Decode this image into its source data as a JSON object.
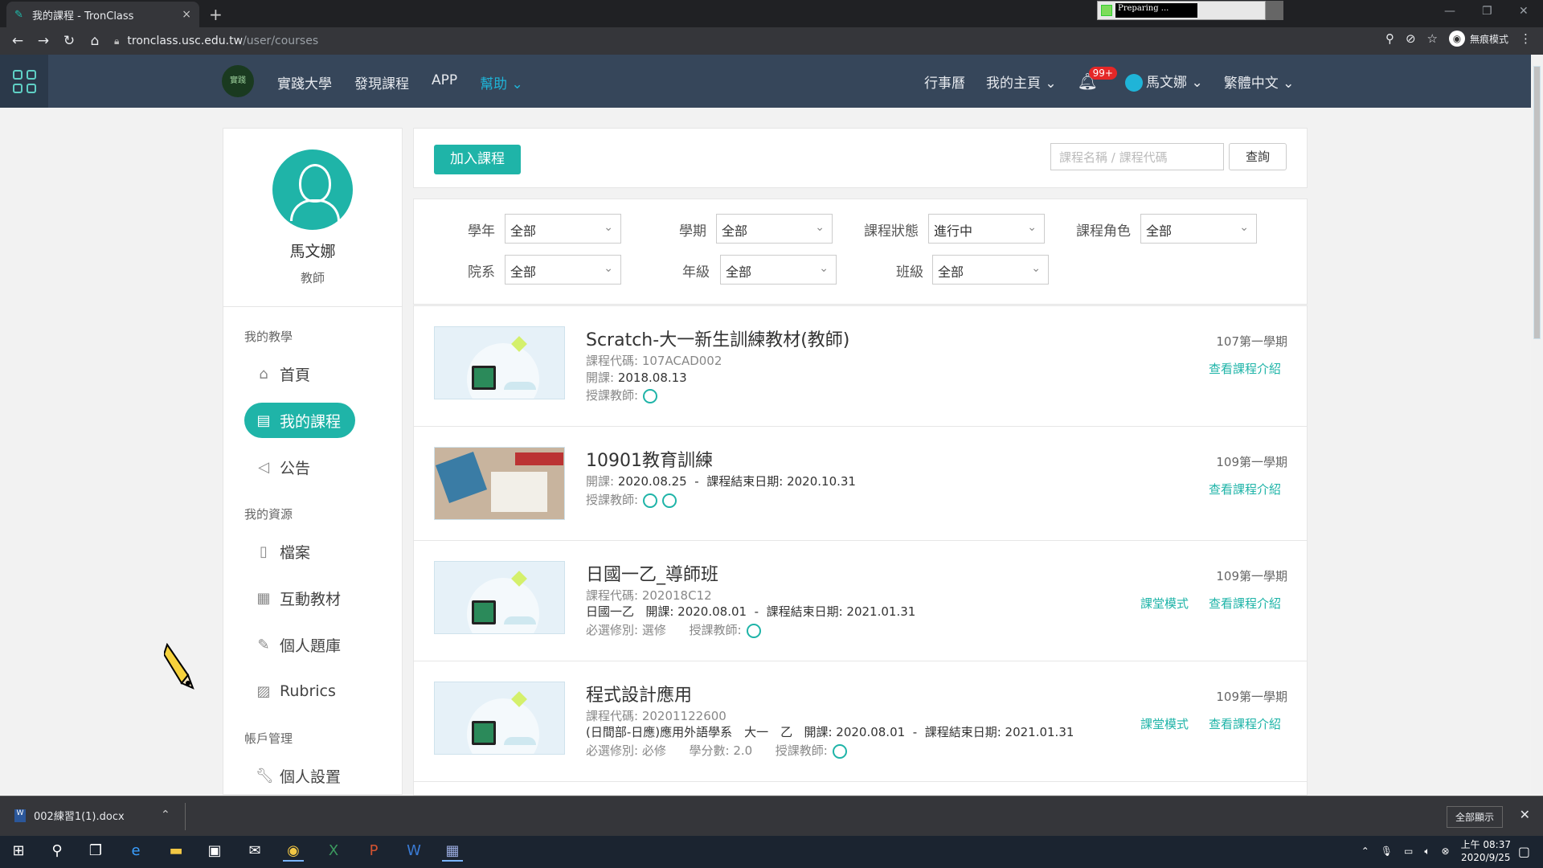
{
  "browser": {
    "tab_title": "我的課程 - TronClass",
    "tab_close": "×",
    "new_tab": "+",
    "preparing": "Preparing ...",
    "url_host": "tronclass.usc.edu.tw",
    "url_path": "/user/courses",
    "incognito": "無痕模式"
  },
  "topnav": {
    "logo_text": "實踐",
    "links": [
      "實踐大學",
      "發現課程",
      "APP"
    ],
    "help": "幫助",
    "calendar": "行事曆",
    "my_home": "我的主頁",
    "notif_count": "99+",
    "user": "馬文娜",
    "language": "繁體中文"
  },
  "sidebar": {
    "name": "馬文娜",
    "role": "教師",
    "section_teaching": "我的教學",
    "home": "首頁",
    "my_courses": "我的課程",
    "announcements": "公告",
    "section_resources": "我的資源",
    "files": "檔案",
    "interactive": "互動教材",
    "question_bank": "個人題庫",
    "rubrics": "Rubrics",
    "section_account": "帳戶管理",
    "settings": "個人設置"
  },
  "toolbar": {
    "join": "加入課程",
    "search_placeholder": "課程名稱 / 課程代碼",
    "query": "查詢"
  },
  "filters": {
    "year_label": "學年",
    "year": "全部",
    "semester_label": "學期",
    "semester": "全部",
    "status_label": "課程狀態",
    "status": "進行中",
    "role_label": "課程角色",
    "role": "全部",
    "dept_label": "院系",
    "dept": "全部",
    "grade_label": "年級",
    "grade": "全部",
    "class_label": "班級",
    "class": "全部"
  },
  "courses": [
    {
      "title": "Scratch-大一新生訓練教材(教師)",
      "code_label": "課程代碼:",
      "code": "107ACAD002",
      "open_label": "開課:",
      "open": "2018.08.13",
      "teacher_label": "授課教師:",
      "term": "107第一學期",
      "intro": "查看課程介紹"
    },
    {
      "title": "10901教育訓練",
      "open_label": "開課:",
      "open": "2020.08.25",
      "end_label": "課程結束日期:",
      "end": "2020.10.31",
      "teacher_label": "授課教師:",
      "term": "109第一學期",
      "intro": "查看課程介紹"
    },
    {
      "title": "日國一乙_導師班",
      "code_label": "課程代碼:",
      "code": "202018C12",
      "class": "日國一乙",
      "open_label": "開課:",
      "open": "2020.08.01",
      "end_label": "課程結束日期:",
      "end": "2021.01.31",
      "req_label": "必選修別:",
      "req": "選修",
      "teacher_label": "授課教師:",
      "term": "109第一學期",
      "classroom": "課堂模式",
      "intro": "查看課程介紹"
    },
    {
      "title": "程式設計應用",
      "code_label": "課程代碼:",
      "code": "20201122600",
      "class": "(日間部-日應)應用外語學系　大一　乙",
      "open_label": "開課:",
      "open": "2020.08.01",
      "end_label": "課程結束日期:",
      "end": "2021.01.31",
      "req_label": "必選修別:",
      "req": "必修",
      "credit_label": "學分數:",
      "credit": "2.0",
      "teacher_label": "授課教師:",
      "term": "109第一學期",
      "classroom": "課堂模式",
      "intro": "查看課程介紹"
    }
  ],
  "downloads": {
    "file": "002練習1(1).docx",
    "show_all": "全部顯示"
  },
  "taskbar": {
    "time": "上午 08:37",
    "date": "2020/9/25"
  }
}
